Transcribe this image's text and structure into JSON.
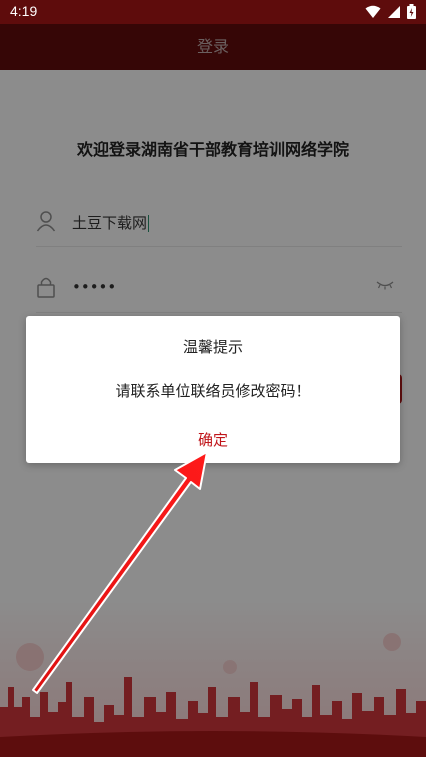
{
  "status_bar": {
    "time": "4:19",
    "icons": [
      "wifi-icon",
      "signal-icon",
      "battery-charging-icon"
    ]
  },
  "header": {
    "title": "登录"
  },
  "login": {
    "welcome": "欢迎登录湖南省干部教育培训网络学院",
    "username_value": "土豆下载网",
    "password_value": "•••••"
  },
  "dialog": {
    "title": "温馨提示",
    "message": "请联系单位联络员修改密码！",
    "confirm_label": "确定"
  },
  "colors": {
    "brand": "#a8191a",
    "header_dimmed": "#5e0c0c",
    "confirm_text": "#c0151a"
  }
}
